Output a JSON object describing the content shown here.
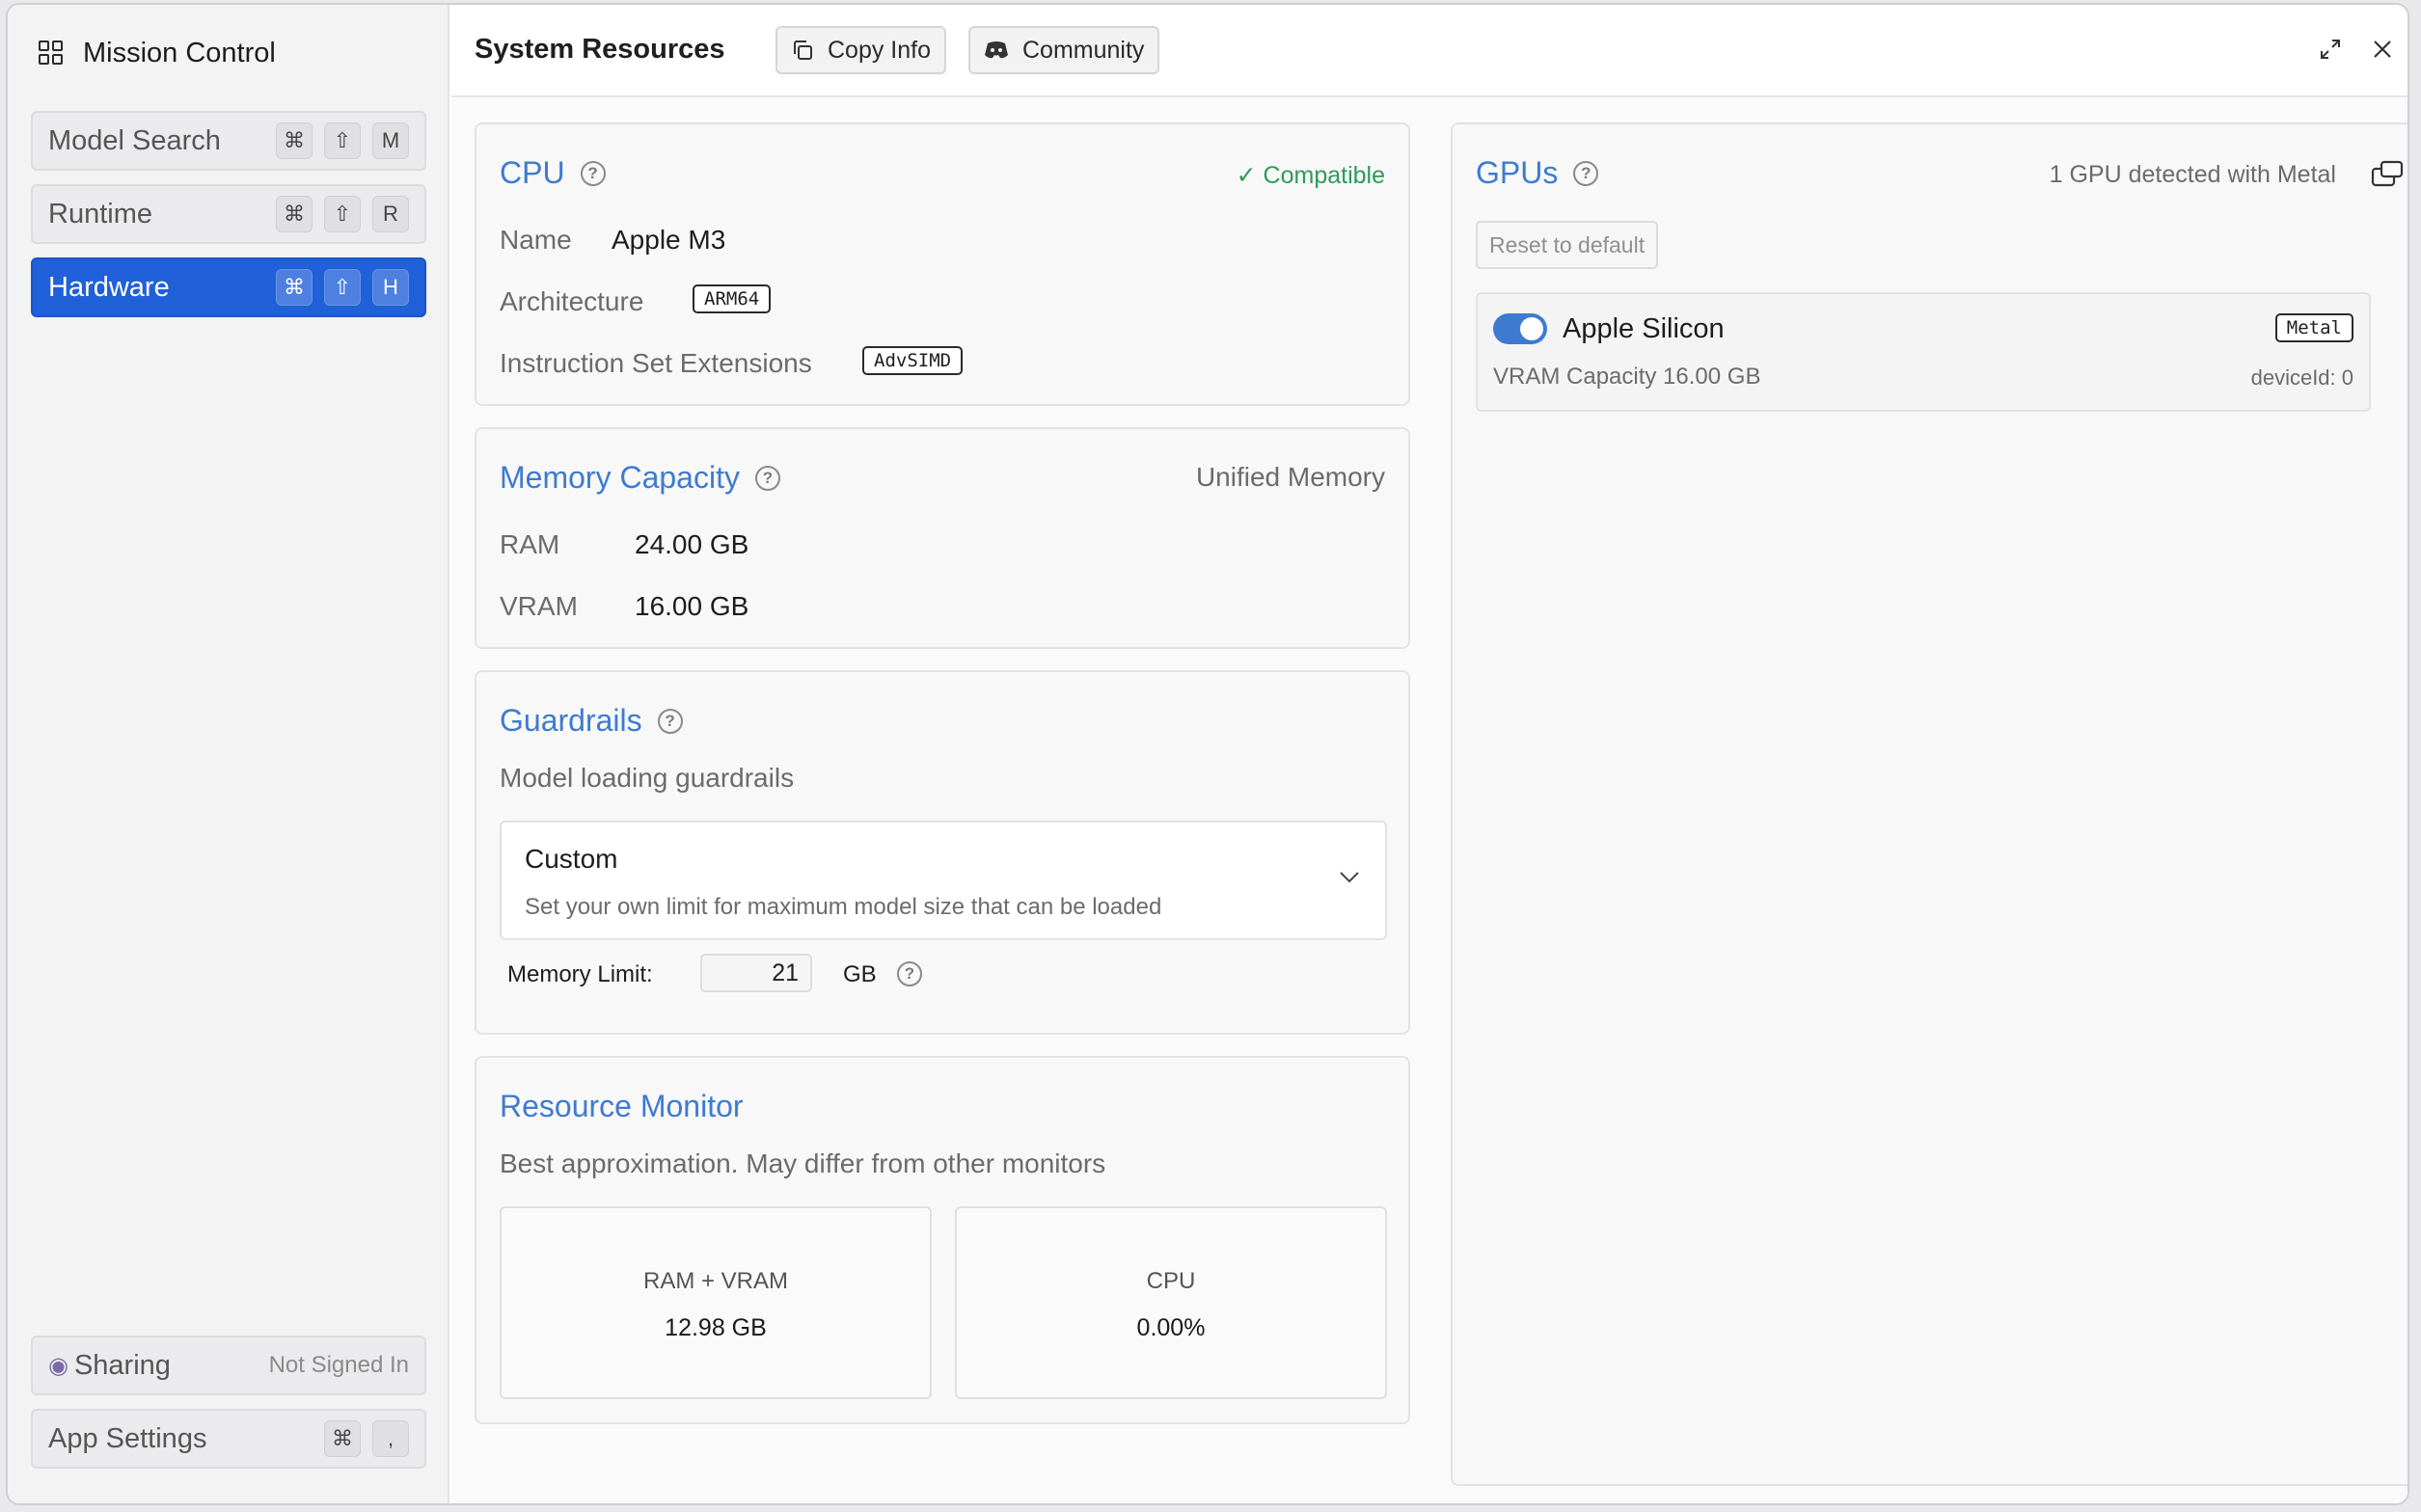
{
  "sidebar": {
    "title": "Mission Control",
    "items": [
      {
        "label": "Model Search",
        "keys": [
          "⌘",
          "⇧",
          "M"
        ]
      },
      {
        "label": "Runtime",
        "keys": [
          "⌘",
          "⇧",
          "R"
        ]
      },
      {
        "label": "Hardware",
        "keys": [
          "⌘",
          "⇧",
          "H"
        ],
        "active": true
      }
    ],
    "sharing": {
      "label": "Sharing",
      "status": "Not Signed In"
    },
    "app_settings": {
      "label": "App Settings",
      "keys": [
        "⌘",
        ","
      ]
    }
  },
  "header": {
    "title": "System Resources",
    "copy_info": "Copy Info",
    "community": "Community"
  },
  "cpu": {
    "title": "CPU",
    "status": "✓ Compatible",
    "name_label": "Name",
    "name_value": "Apple M3",
    "arch_label": "Architecture",
    "arch_value": "ARM64",
    "ext_label": "Instruction Set Extensions",
    "ext_value": "AdvSIMD"
  },
  "memory": {
    "title": "Memory Capacity",
    "type": "Unified Memory",
    "ram_label": "RAM",
    "ram_value": "24.00 GB",
    "vram_label": "VRAM",
    "vram_value": "16.00 GB"
  },
  "guardrails": {
    "title": "Guardrails",
    "subtitle": "Model loading guardrails",
    "selected": "Custom",
    "selected_desc": "Set your own limit for maximum model size that can be loaded",
    "limit_label": "Memory Limit:",
    "limit_value": "21",
    "limit_unit": "GB"
  },
  "monitor": {
    "title": "Resource Monitor",
    "subtitle": "Best approximation. May differ from other monitors",
    "ram_label": "RAM + VRAM",
    "ram_value": "12.98 GB",
    "cpu_label": "CPU",
    "cpu_value": "0.00%"
  },
  "gpus": {
    "title": "GPUs",
    "detected": "1 GPU detected with Metal",
    "reset": "Reset to default",
    "device": {
      "name": "Apple Silicon",
      "enabled": true,
      "api": "Metal",
      "vram": "VRAM Capacity 16.00 GB",
      "device_id": "deviceId: 0"
    }
  },
  "colors": {
    "accent": "#3d7bd0",
    "active_nav": "#2060d8",
    "compatible": "#2f9a5a"
  }
}
